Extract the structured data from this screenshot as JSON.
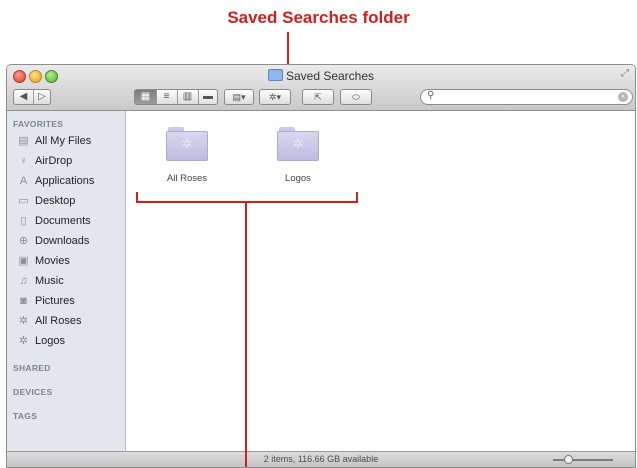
{
  "callout": {
    "label": "Saved Searches folder"
  },
  "window": {
    "title": "Saved Searches"
  },
  "toolbar": {
    "back": "◀",
    "forward": "▷",
    "search": {
      "placeholder": ""
    }
  },
  "sidebar": {
    "sections": {
      "favorites": "FAVORITES",
      "shared": "SHARED",
      "devices": "DEVICES",
      "tags": "TAGS"
    },
    "items": [
      {
        "label": "All My Files",
        "icon": "all-my-files-icon"
      },
      {
        "label": "AirDrop",
        "icon": "airdrop-icon"
      },
      {
        "label": "Applications",
        "icon": "applications-icon"
      },
      {
        "label": "Desktop",
        "icon": "desktop-icon"
      },
      {
        "label": "Documents",
        "icon": "documents-icon"
      },
      {
        "label": "Downloads",
        "icon": "downloads-icon"
      },
      {
        "label": "Movies",
        "icon": "movies-icon"
      },
      {
        "label": "Music",
        "icon": "music-icon"
      },
      {
        "label": "Pictures",
        "icon": "pictures-icon"
      },
      {
        "label": "All Roses",
        "icon": "gear-icon"
      },
      {
        "label": "Logos",
        "icon": "gear-icon"
      }
    ]
  },
  "content": {
    "files": [
      {
        "name": "All Roses"
      },
      {
        "name": "Logos"
      }
    ]
  },
  "status": {
    "text": "2 items, 116.66 GB available"
  },
  "colors": {
    "callout": "#d11f1f",
    "sidebar": "#e3e7ed",
    "folder": "#c9c8e6"
  }
}
